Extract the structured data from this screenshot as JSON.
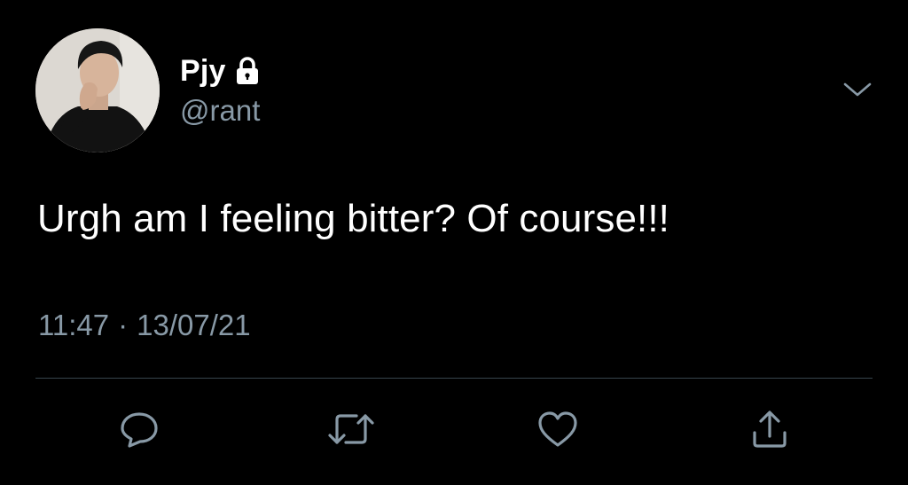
{
  "tweet": {
    "display_name": "Pjy",
    "handle": "@rant",
    "text": "Urgh am I feeling bitter? Of course!!!",
    "time": "11:47",
    "separator": "·",
    "date": "13/07/21"
  },
  "icons": {
    "lock": "lock-icon",
    "chevron": "chevron-down-icon",
    "reply": "reply-icon",
    "retweet": "retweet-icon",
    "like": "heart-icon",
    "share": "share-icon"
  },
  "colors": {
    "background": "#000000",
    "primary_text": "#ffffff",
    "secondary_text": "#8899a6",
    "divider": "#38444d"
  }
}
